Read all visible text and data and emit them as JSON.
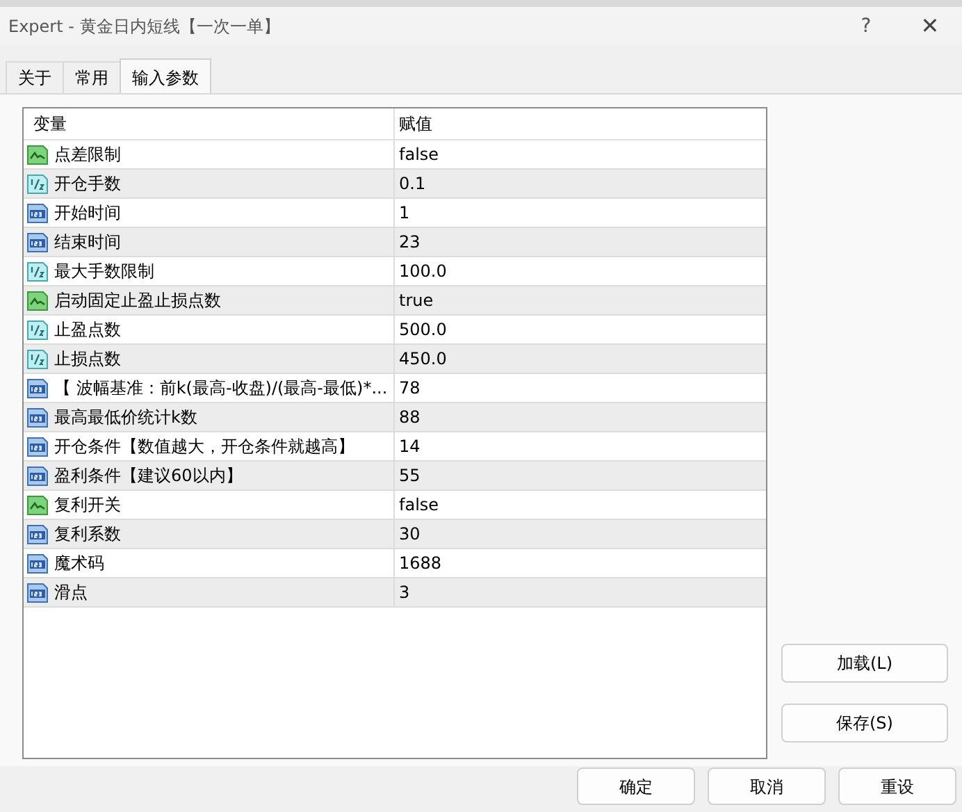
{
  "window": {
    "title": "Expert - 黄金日内短线【一次一单】",
    "help": "?",
    "close": "✕"
  },
  "tabs": [
    {
      "label": "关于",
      "selected": false
    },
    {
      "label": "常用",
      "selected": false
    },
    {
      "label": "输入参数",
      "selected": true
    }
  ],
  "table": {
    "columns": [
      "变量",
      "赋值"
    ],
    "rows": [
      {
        "kind": "bool",
        "name": "点差限制",
        "value": "false"
      },
      {
        "kind": "double",
        "name": "开仓手数",
        "value": "0.1"
      },
      {
        "kind": "int",
        "name": "开始时间",
        "value": "1"
      },
      {
        "kind": "int",
        "name": "结束时间",
        "value": "23"
      },
      {
        "kind": "double",
        "name": "最大手数限制",
        "value": "100.0"
      },
      {
        "kind": "bool",
        "name": "启动固定止盈止损点数",
        "value": "true"
      },
      {
        "kind": "double",
        "name": "止盈点数",
        "value": "500.0"
      },
      {
        "kind": "double",
        "name": "止损点数",
        "value": "450.0"
      },
      {
        "kind": "int",
        "name": "【 波幅基准：前k(最高-收盘)/(最高-最低)*...",
        "value": "78"
      },
      {
        "kind": "int",
        "name": "最高最低价统计k数",
        "value": "88"
      },
      {
        "kind": "int",
        "name": "开仓条件【数值越大，开仓条件就越高】",
        "value": "14"
      },
      {
        "kind": "int",
        "name": "盈利条件【建议60以内】",
        "value": "55"
      },
      {
        "kind": "bool",
        "name": "复利开关",
        "value": "false"
      },
      {
        "kind": "int",
        "name": "复利系数",
        "value": "30"
      },
      {
        "kind": "int",
        "name": "魔术码",
        "value": "1688"
      },
      {
        "kind": "int",
        "name": "滑点",
        "value": "3"
      }
    ]
  },
  "side_buttons": [
    "加载(L)",
    "保存(S)"
  ],
  "buttons": [
    "确定",
    "取消",
    "重设"
  ]
}
